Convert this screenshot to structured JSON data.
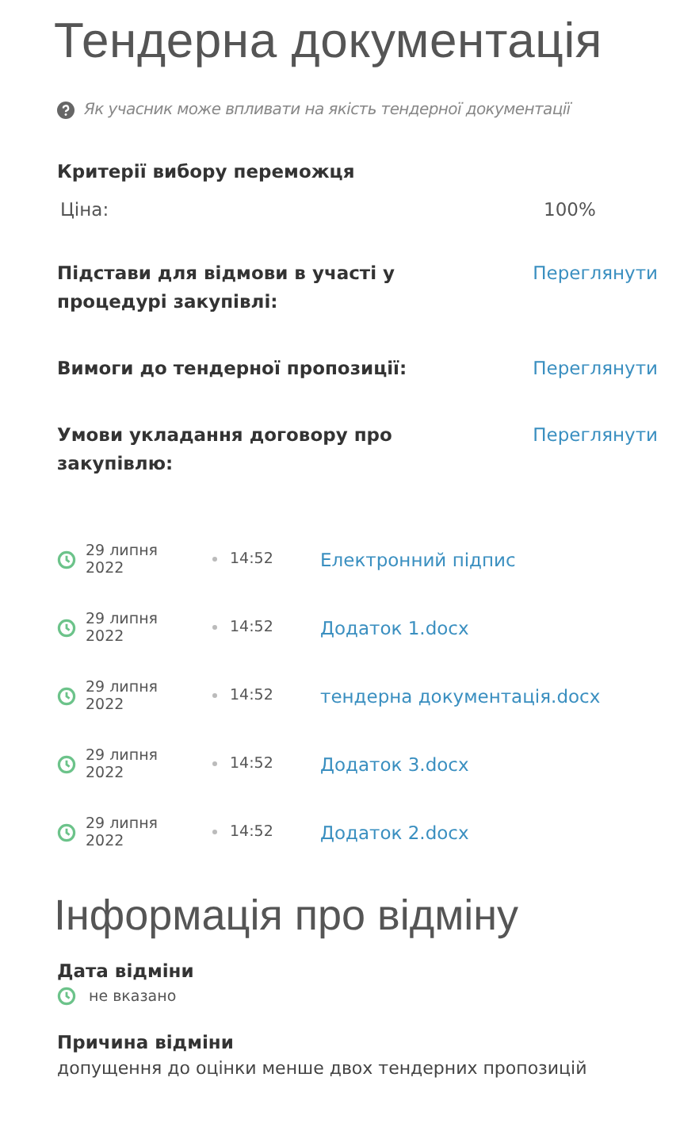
{
  "title": "Тендерна документація",
  "help_link": "Як учасник може впливати на якість тендерної документації",
  "criteria": {
    "heading": "Критерії вибору переможця",
    "items": [
      {
        "label": "Ціна:",
        "value": "100%"
      }
    ]
  },
  "requirements": [
    {
      "label": "Підстави для відмови в участі у процедурі закупівлі:",
      "link": "Переглянути"
    },
    {
      "label": "Вимоги до тендерної пропозиції:",
      "link": "Переглянути"
    },
    {
      "label": "Умови укладання договору про закупівлю:",
      "link": "Переглянути"
    }
  ],
  "documents": [
    {
      "date": "29 липня 2022",
      "time": "14:52",
      "name": "Електронний підпис"
    },
    {
      "date": "29 липня 2022",
      "time": "14:52",
      "name": "Додаток 1.docx"
    },
    {
      "date": "29 липня 2022",
      "time": "14:52",
      "name": "тендерна документація.docx"
    },
    {
      "date": "29 липня 2022",
      "time": "14:52",
      "name": "Додаток 3.docx"
    },
    {
      "date": "29 липня 2022",
      "time": "14:52",
      "name": "Додаток 2.docx"
    }
  ],
  "cancellation": {
    "title": "Інформація про відміну",
    "date_label": "Дата відміни",
    "date_value": "не вказано",
    "reason_label": "Причина відміни",
    "reason": "допущення до оцінки менше двох тендерних пропозицій"
  }
}
